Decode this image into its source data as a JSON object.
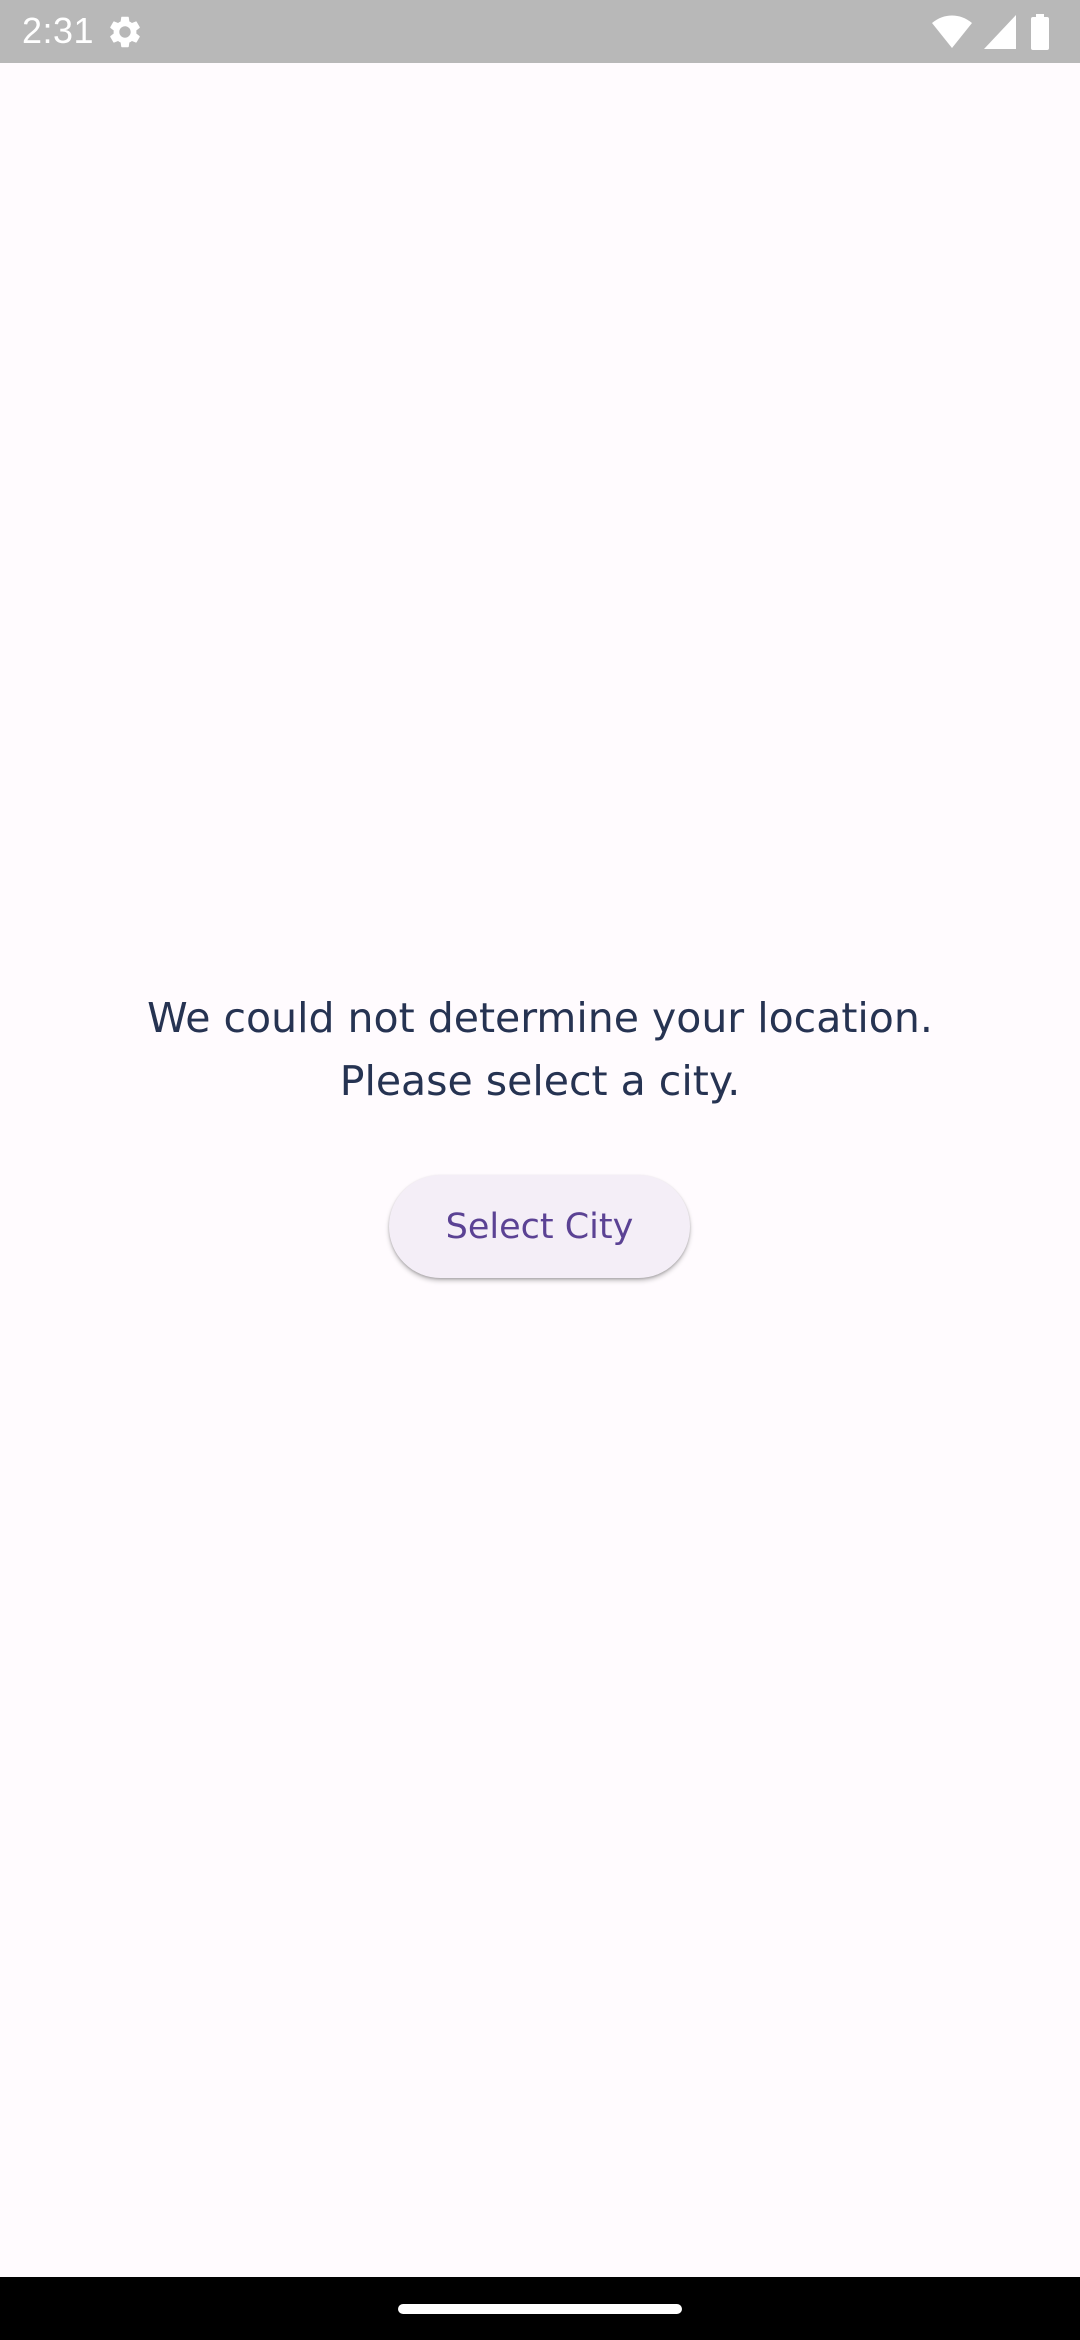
{
  "status_bar": {
    "time": "2:31",
    "icons": [
      "settings-gear-icon",
      "wifi-icon",
      "cellular-signal-icon",
      "battery-icon"
    ]
  },
  "content": {
    "message_line1": "We could not determine your location.",
    "message_line2": "Please select a city.",
    "select_city_label": "Select City"
  },
  "colors": {
    "background": "#fffbfe",
    "status_bar": "#b8b8b8",
    "message_text": "#263352",
    "button_bg": "#f4eef7",
    "button_text": "#5b4294",
    "nav_bar": "#000000"
  }
}
